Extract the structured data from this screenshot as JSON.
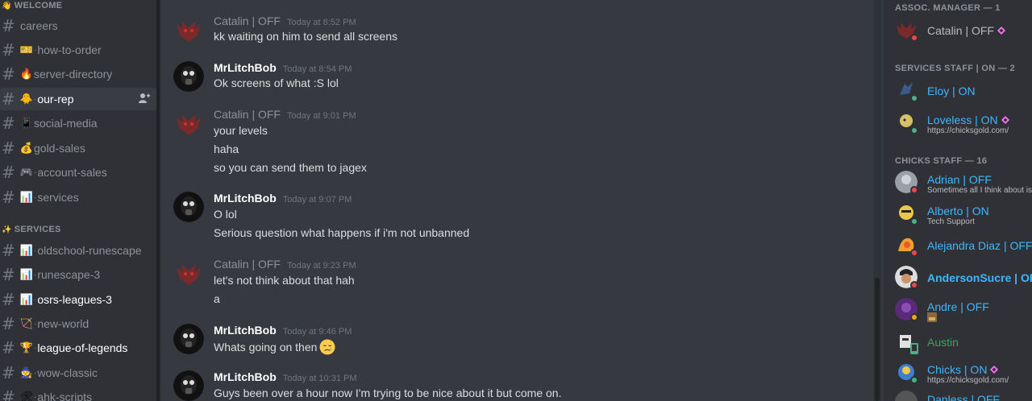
{
  "sidebar": {
    "categories": [
      {
        "label": "WELCOME",
        "icon": "wave-icon"
      },
      {
        "label": "SERVICES",
        "icon": "sparkles-icon"
      }
    ],
    "channels": [
      {
        "name": "careers",
        "emoji": "",
        "dot": false
      },
      {
        "name": "how-to-order",
        "emoji": "🎫",
        "dot": true
      },
      {
        "name": "server-directory",
        "emoji": "🔥",
        "dot": false
      },
      {
        "name": "our-rep",
        "emoji": "🐥",
        "dot": true,
        "active": true
      },
      {
        "name": "social-media",
        "emoji": "📱",
        "dot": false
      },
      {
        "name": "gold-sales",
        "emoji": "💰",
        "dot": false
      },
      {
        "name": "account-sales",
        "emoji": "🎮",
        "dot": true
      },
      {
        "name": "services",
        "emoji": "📊",
        "dot": true
      },
      {
        "name": "oldschool-runescape",
        "emoji": "📊",
        "dot": true
      },
      {
        "name": "runescape-3",
        "emoji": "📊",
        "dot": true
      },
      {
        "name": "osrs-leagues-3",
        "emoji": "📊",
        "dot": true,
        "bright": true
      },
      {
        "name": "new-world",
        "emoji": "🏹",
        "dot": true
      },
      {
        "name": "league-of-legends",
        "emoji": "🏆",
        "dot": true,
        "bright": true
      },
      {
        "name": "wow-classic",
        "emoji": "🧙",
        "dot": true
      },
      {
        "name": "ahk-scripts",
        "emoji": "🛠",
        "dot": true
      }
    ]
  },
  "messages": [
    {
      "author": "Catalin | OFF",
      "time": "Today at 8:52 PM",
      "lines": [
        "kk waiting on him to send all screens"
      ]
    },
    {
      "author": "MrLitchBob",
      "time": "Today at 8:54 PM",
      "lines": [
        "Ok screens of what :S lol"
      ]
    },
    {
      "author": "Catalin | OFF",
      "time": "Today at 9:01 PM",
      "lines": [
        "your levels",
        "haha",
        "so you can send them to jagex"
      ]
    },
    {
      "author": "MrLitchBob",
      "time": "Today at 9:07 PM",
      "lines": [
        "O lol",
        "Serious question what happens if i'm not unbanned"
      ]
    },
    {
      "author": "Catalin | OFF",
      "time": "Today at 9:23 PM",
      "lines": [
        "let's not think about that hah",
        "a"
      ]
    },
    {
      "author": "MrLitchBob",
      "time": "Today at 9:46 PM",
      "lines": [
        "Whats going on then"
      ]
    },
    {
      "author": "MrLitchBob",
      "time": "Today at 10:31 PM",
      "lines": [
        "Guys been over a hour now I'm trying to be nice about it but come on."
      ]
    }
  ],
  "members": {
    "groups": [
      {
        "label": "ASSOC. MANAGER — 1"
      },
      {
        "label": "SERVICES STAFF | ON — 2"
      },
      {
        "label": "CHICKS STAFF — 16"
      }
    ],
    "people": [
      {
        "name": "Catalin | OFF",
        "color": "#b9bbbe",
        "status": "dnd",
        "sub": "",
        "gem": true
      },
      {
        "name": "Eloy | ON",
        "color": "#3fb7ff",
        "status": "online",
        "sub": "",
        "gem": false
      },
      {
        "name": "Loveless | ON",
        "color": "#3fb7ff",
        "status": "online",
        "sub": "https://chicksgold.com/",
        "gem": true
      },
      {
        "name": "Adrian | OFF",
        "color": "#3fb7ff",
        "status": "dnd",
        "sub": "Sometimes all I think about is",
        "gem": false
      },
      {
        "name": "Alberto | ON",
        "color": "#3fb7ff",
        "status": "online",
        "sub": "Tech Support",
        "gem": false
      },
      {
        "name": "Alejandra Diaz | OFF",
        "color": "#3fb7ff",
        "status": "dnd",
        "sub": "",
        "gem": false
      },
      {
        "name": "AndersonSucre | OFF",
        "color": "#3fb7ff",
        "status": "dnd",
        "sub": "",
        "gem": false
      },
      {
        "name": "Andre | OFF",
        "color": "#3fb7ff",
        "status": "idle",
        "sub": "",
        "gem": false
      },
      {
        "name": "Austin",
        "color": "#3ba55c",
        "status": "dnd",
        "sub": "",
        "gem": false
      },
      {
        "name": "Chicks | ON",
        "color": "#3fb7ff",
        "status": "online",
        "sub": "https://chicksgold.com/",
        "gem": true
      },
      {
        "name": "Danless | OFF",
        "color": "#3fb7ff",
        "status": "dnd",
        "sub": "",
        "gem": false
      }
    ]
  },
  "colors": {
    "accent": "#3fb7ff",
    "online": "#43b581",
    "dnd": "#f04747",
    "idle": "#faa61a",
    "nitro": "#ff73fa"
  }
}
